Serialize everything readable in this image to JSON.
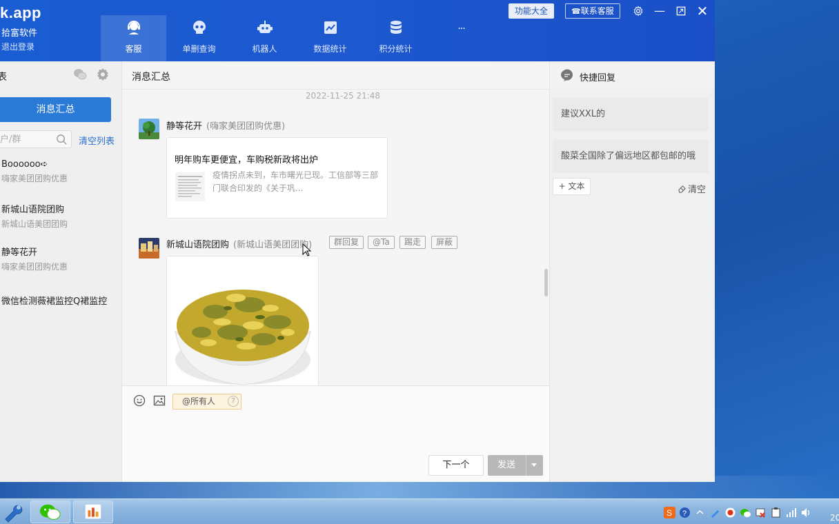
{
  "header": {
    "brand": "k.app",
    "brand_sub": "拾富软件",
    "logout": "退出登录",
    "nav": [
      {
        "label": "客服",
        "icon": "customer-service-icon"
      },
      {
        "label": "单删查询",
        "icon": "skull-icon"
      },
      {
        "label": "机器人",
        "icon": "robot-icon"
      },
      {
        "label": "数据统计",
        "icon": "chart-icon"
      },
      {
        "label": "积分统计",
        "icon": "database-icon"
      },
      {
        "label": "···",
        "icon": "more-icon"
      }
    ],
    "func_btn": "功能大全",
    "contact_btn": "联系客服"
  },
  "sidebar": {
    "title": "表",
    "summary_btn": "消息汇总",
    "search_placeholder": "户/群",
    "clear_list": "清空列表",
    "items": [
      {
        "name": "Boooooo➪",
        "sub": "嗨家美团团购优惠"
      },
      {
        "name": "新城山语院团购",
        "sub": "新城山语美团团购"
      },
      {
        "name": "静等花开",
        "sub": "嗨家美团团购优惠"
      },
      {
        "name": "微信检测薇裙监控Q裙监控",
        "sub": ""
      }
    ]
  },
  "chat": {
    "title": "消息汇总",
    "timestamp": "2022-11-25 21:48",
    "msg1": {
      "sender": "静等花开",
      "group": "(嗨家美团团购优惠)",
      "card_title": "明年购车更便宜，车购税新政将出炉",
      "card_desc": "疫情拐点未到，车市曙光已现。工信部等三部门联合印发的《关于巩..."
    },
    "msg2": {
      "sender": "新城山语院团购",
      "group": "(新城山语美团团购)",
      "actions": [
        "群回复",
        "@Ta",
        "踢走",
        "屏蔽"
      ]
    }
  },
  "input": {
    "at_all": "@所有人",
    "help": "?",
    "next": "下一个",
    "send": "发送"
  },
  "quick_reply": {
    "title": "快捷回复",
    "items": [
      "建议XXL的",
      "酸菜全国除了偏远地区都包邮的哦"
    ],
    "add_text": "+ 文本",
    "clear": "清空"
  },
  "taskbar": {
    "clock": "20"
  },
  "colors": {
    "header_blue": "#1a5cd1",
    "accent_blue": "#2a7bd8",
    "send_disabled": "#b8b8b8"
  }
}
